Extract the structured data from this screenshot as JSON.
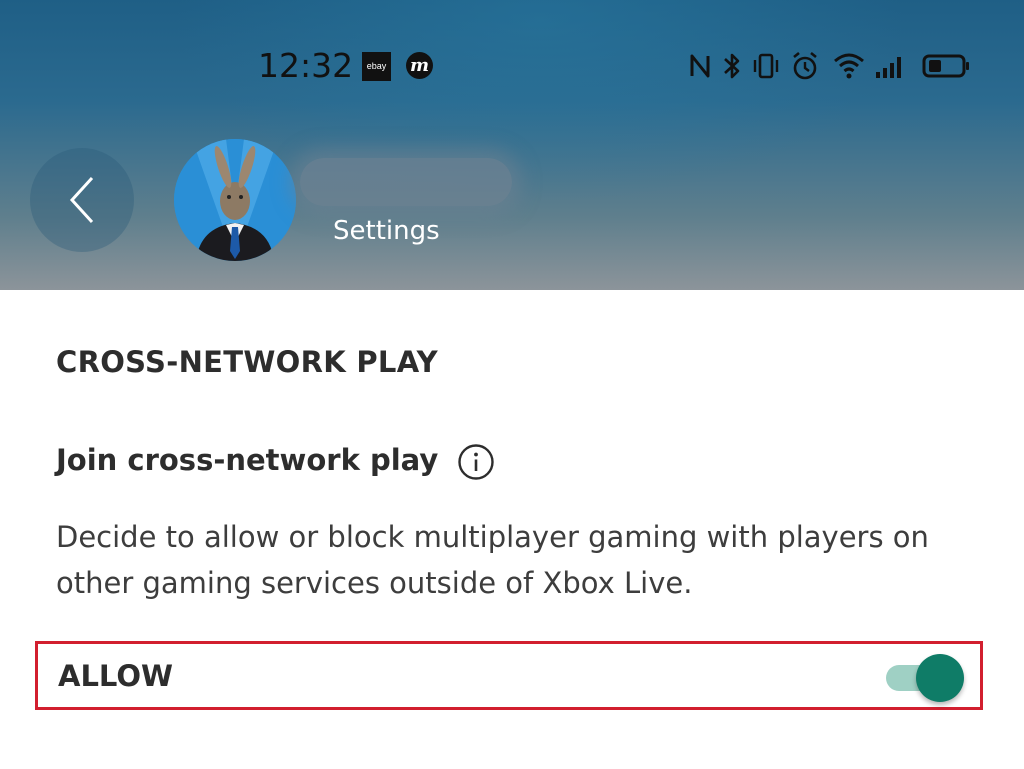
{
  "status_bar": {
    "time": "12:32",
    "ebay_label": "ebay",
    "messenger_label": "m",
    "icons": [
      "nfc-icon",
      "bluetooth-icon",
      "vibrate-icon",
      "alarm-icon",
      "wifi-icon",
      "signal-icon",
      "battery-icon"
    ]
  },
  "header": {
    "subtitle": "Settings",
    "back_icon": "chevron-left-icon",
    "avatar": "avatar"
  },
  "content": {
    "section_title": "CROSS-NETWORK PLAY",
    "setting_title": "Join cross-network play",
    "info_icon": "info-icon",
    "description": "Decide to allow or block multiplayer gaming with players on other gaming services outside of Xbox Live.",
    "allow_label": "ALLOW",
    "allow_toggle_on": true
  },
  "colors": {
    "toggle_thumb": "#0f7c67",
    "toggle_track": "#9fd0c4",
    "highlight_border": "#d21f2f"
  }
}
